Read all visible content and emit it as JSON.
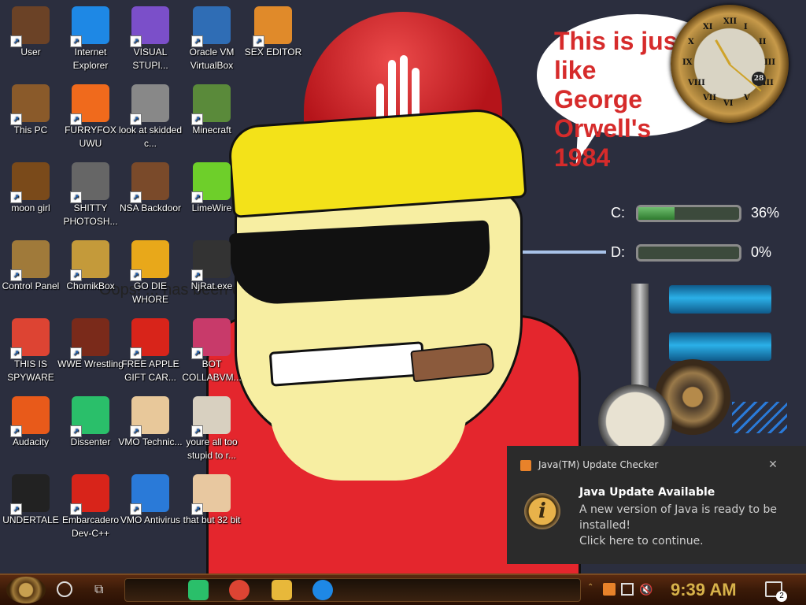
{
  "wallpaper": {
    "speech_text": "This is just like George Orwell's 1984",
    "speech_line1": "This is just like",
    "speech_line2": "George Orwell's",
    "speech_line3": "1984",
    "background_text": "Oops! ... has been deemed inap"
  },
  "desktop_icons": [
    {
      "label": "User",
      "icon": "user-folder-icon",
      "color": "#6b4226"
    },
    {
      "label": "Internet Explorer",
      "icon": "edge-icon",
      "color": "#1e88e5"
    },
    {
      "label": "VISUAL STUPI...",
      "icon": "visual-studio-icon",
      "color": "#7b4fc9"
    },
    {
      "label": "Oracle VM VirtualBox",
      "icon": "virtualbox-icon",
      "color": "#2f6db5"
    },
    {
      "label": "SEX EDITOR",
      "icon": "hex-editor-icon",
      "color": "#e08a2a"
    },
    {
      "label": "This PC",
      "icon": "this-pc-icon",
      "color": "#8a5a2a"
    },
    {
      "label": "FURRYFOX UWU",
      "icon": "firefox-icon",
      "color": "#f06a1c"
    },
    {
      "label": "look at skidded c...",
      "icon": "folder-stack-icon",
      "color": "#888888"
    },
    {
      "label": "Minecraft",
      "icon": "minecraft-icon",
      "color": "#5a8a3a"
    },
    {
      "label": "moon girl",
      "icon": "folder-icon",
      "color": "#7a4a1a"
    },
    {
      "label": "SHITTY PHOTOSH...",
      "icon": "gimp-icon",
      "color": "#666666"
    },
    {
      "label": "NSA Backdoor",
      "icon": "backdoor-icon",
      "color": "#7a4a2a"
    },
    {
      "label": "LimeWire",
      "icon": "limewire-icon",
      "color": "#6ecf2a"
    },
    {
      "label": "Control Panel",
      "icon": "control-panel-icon",
      "color": "#a07a3a"
    },
    {
      "label": "ChomikBox",
      "icon": "chomikbox-icon",
      "color": "#c49a3a"
    },
    {
      "label": "GO DIE WHORE",
      "icon": "de-icon",
      "color": "#e8a81a"
    },
    {
      "label": "NjRat.exe",
      "icon": "skull-icon",
      "color": "#333333"
    },
    {
      "label": "THIS IS SPYWARE",
      "icon": "chrome-icon",
      "color": "#dd4433"
    },
    {
      "label": "WWE Wrestling",
      "icon": "oven-icon",
      "color": "#7a2a1a"
    },
    {
      "label": "FREE APPLE GIFT CAR...",
      "icon": "apple-icon",
      "color": "#d8241a"
    },
    {
      "label": "BOT COLLABVM...",
      "icon": "monitor-icon",
      "color": "#c83a6a"
    },
    {
      "label": "Audacity",
      "icon": "audacity-icon",
      "color": "#e85a1a"
    },
    {
      "label": "Dissenter",
      "icon": "dissenter-icon",
      "color": "#2abf6a"
    },
    {
      "label": "VMO Technic...",
      "icon": "doctor-icon",
      "color": "#e8c89a"
    },
    {
      "label": "youre all too stupid to r...",
      "icon": "portrait-icon",
      "color": "#d8d0c0"
    },
    {
      "label": "UNDERTALE",
      "icon": "unity-icon",
      "color": "#222222"
    },
    {
      "label": "Embarcadero Dev-C++",
      "icon": "devcpp-icon",
      "color": "#d8241a"
    },
    {
      "label": "VMO Antivirus",
      "icon": "shield-icon",
      "color": "#2a7ad8"
    },
    {
      "label": "that but 32 bit",
      "icon": "portrait-lady-icon",
      "color": "#e8c8a0"
    }
  ],
  "gadgets": {
    "clock_date": "28",
    "clock_numerals": [
      "XII",
      "I",
      "II",
      "III",
      "IIII",
      "V",
      "VI",
      "VII",
      "VIII",
      "IX",
      "X",
      "XI"
    ],
    "drives": [
      {
        "label": "C:",
        "percent_text": "36%",
        "percent": 36
      },
      {
        "label": "D:",
        "percent_text": "0%",
        "percent": 0
      }
    ]
  },
  "notification": {
    "app_name": "Java(TM) Update Checker",
    "title": "Java Update Available",
    "message_line1": "A new version of Java is ready to be installed!",
    "message_line2": "Click here to continue.",
    "big_icon_letter": "i"
  },
  "taskbar": {
    "clock": "9:39 AM",
    "notification_count": "2",
    "pinned": [
      {
        "name": "dissenter-taskbar-icon",
        "color": "#2abf6a"
      },
      {
        "name": "chrome-taskbar-icon",
        "color": "#dd4433"
      },
      {
        "name": "file-explorer-taskbar-icon",
        "color": "#e8b83a"
      },
      {
        "name": "edge-taskbar-icon",
        "color": "#1e88e5"
      }
    ]
  }
}
